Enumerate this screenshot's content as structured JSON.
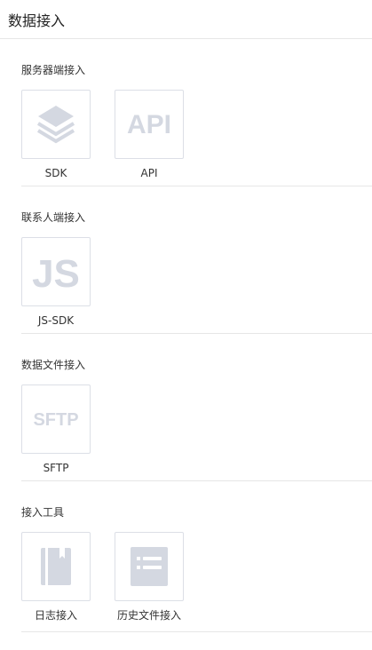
{
  "page": {
    "title": "数据接入"
  },
  "sections": [
    {
      "title": "服务器端接入",
      "items": [
        {
          "label": "SDK",
          "icon": "layers-icon"
        },
        {
          "label": "API",
          "icon": "api-text-icon",
          "icon_text": "API"
        }
      ]
    },
    {
      "title": "联系人端接入",
      "items": [
        {
          "label": "JS-SDK",
          "icon": "js-text-icon",
          "icon_text": "JS"
        }
      ]
    },
    {
      "title": "数据文件接入",
      "items": [
        {
          "label": "SFTP",
          "icon": "sftp-text-icon",
          "icon_text": "SFTP"
        }
      ]
    },
    {
      "title": "接入工具",
      "items": [
        {
          "label": "日志接入",
          "icon": "book-icon"
        },
        {
          "label": "历史文件接入",
          "icon": "list-doc-icon"
        }
      ]
    }
  ],
  "colors": {
    "icon": "#d4d8e1",
    "border": "#dcdfe6",
    "divider": "#e6e6e6"
  }
}
